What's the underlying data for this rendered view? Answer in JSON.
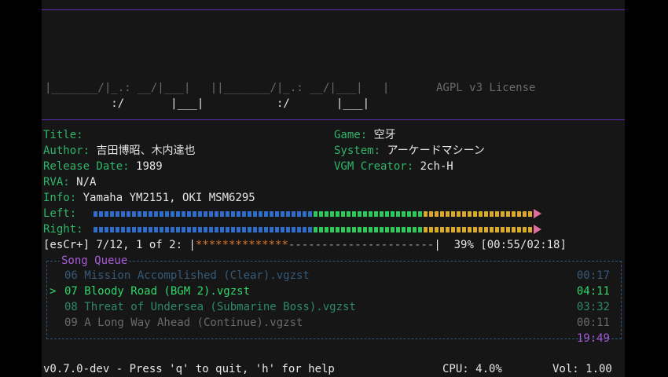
{
  "logo": {
    "line1": "|_______/|_.: __/|___|   ||_______/|_.: __/|___|   |",
    "line2": "          :/       |___|           :/       |___|",
    "license": "AGPL v3 License"
  },
  "meta": {
    "title_label": "Title:",
    "title_value": "",
    "author_label": "Author:",
    "author_value": "吉田博昭、木内達也",
    "release_label": "Release Date:",
    "release_value": "1989",
    "rva_label": "RVA:",
    "rva_value": "N/A",
    "info_label": "Info:",
    "info_value": "Yamaha YM2151, OKI MSM6295",
    "game_label": "Game:",
    "game_value": "空牙",
    "system_label": "System:",
    "system_value": "アーケードマシーン",
    "creator_label": "VGM Creator:",
    "creator_value": "2ch-H"
  },
  "meters": {
    "left_label": "Left:",
    "right_label": "Right:",
    "left_level": 1.0,
    "right_level": 1.0,
    "colors": {
      "low": "#2f6ec8",
      "mid": "#2fc85a",
      "high": "#d8a92a",
      "arrow": "#e06c9c"
    }
  },
  "progress": {
    "prefix": "[esCr+] 7/12, 1 of 2: |",
    "filled": "**************",
    "empty": "----------------------",
    "suffix": "|  39% [00:55/02:18]",
    "percent": 39,
    "colors": {
      "filled": "#d8742a"
    }
  },
  "queue": {
    "title": "Song Queue",
    "items": [
      {
        "name": "06 Mission Accomplished (Clear).vgzst",
        "duration": "00:17",
        "state": "past",
        "cursor": ""
      },
      {
        "name": "07 Bloody Road (BGM 2).vgzst",
        "duration": "04:11",
        "state": "current",
        "cursor": ">"
      },
      {
        "name": "08 Threat of Undersea (Submarine Boss).vgzst",
        "duration": "03:32",
        "state": "next",
        "cursor": ""
      },
      {
        "name": "09 A Long Way Ahead (Continue).vgzst",
        "duration": "00:11",
        "state": "upcoming",
        "cursor": ""
      }
    ],
    "total": "19:49",
    "colors": {
      "past": "#355a7a",
      "current": "#2fd86a",
      "next": "#2f8a6a",
      "upcoming": "#6a6a6a",
      "total": "#a95bd9"
    }
  },
  "status": {
    "help": "v0.7.0-dev - Press 'q' to quit, 'h' for help",
    "cpu": "CPU: 4.0%",
    "volume": "Vol: 1.00"
  }
}
